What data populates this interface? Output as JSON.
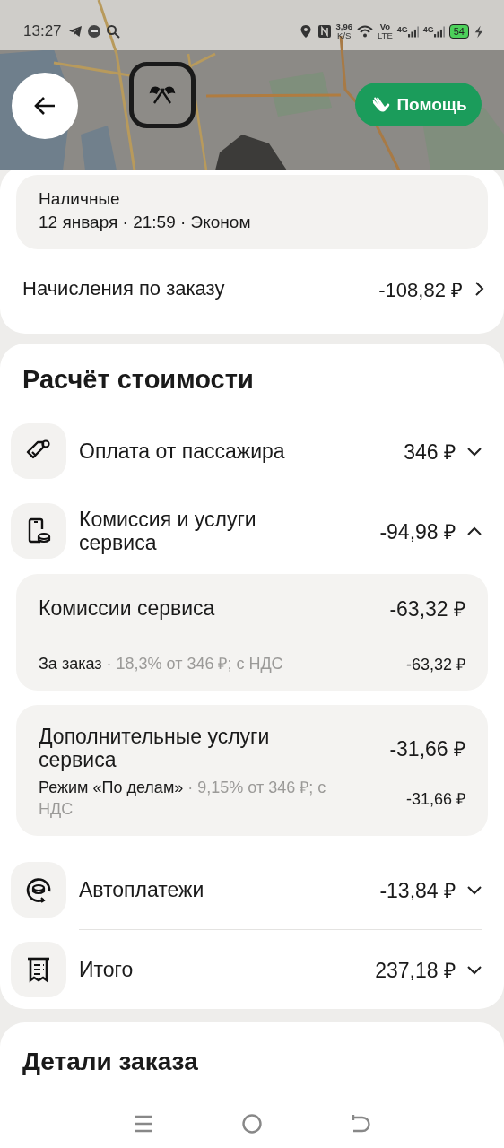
{
  "status_bar": {
    "time": "13:27",
    "network_speed": "3,96",
    "speed_unit": "K/S",
    "volte_top": "Vo",
    "volte_bottom": "LTE",
    "signals": [
      "4G",
      "4G"
    ],
    "battery": "54"
  },
  "help_button": {
    "label": "Помощь"
  },
  "order_summary": {
    "payment": "Наличные",
    "details": "12 января · 21:59 · Эконом"
  },
  "accruals": {
    "label": "Начисления по заказу",
    "amount": "-108,82 ₽"
  },
  "cost_breakdown": {
    "title": "Расчёт стоимости",
    "items": [
      {
        "label": "Оплата от пассажира",
        "amount": "346 ₽",
        "expanded": false
      },
      {
        "label": "Комиссия и услуги сервиса",
        "amount": "-94,98 ₽",
        "expanded": true,
        "details": [
          {
            "title": "Комиссии сервиса",
            "amount": "-63,32 ₽",
            "lines": [
              {
                "label": "За заказ",
                "note": "· 18,3% от 346 ₽; с НДС",
                "amount": "-63,32 ₽"
              }
            ]
          },
          {
            "title": "Дополнительные услуги сервиса",
            "amount": "-31,66 ₽",
            "lines": [
              {
                "label": "Режим «По делам»",
                "note": "· 9,15% от 346 ₽; с НДС",
                "amount": "-31,66 ₽"
              }
            ]
          }
        ]
      },
      {
        "label": "Автоплатежи",
        "amount": "-13,84 ₽",
        "expanded": false
      },
      {
        "label": "Итого",
        "amount": "237,18 ₽",
        "expanded": false
      }
    ]
  },
  "order_details": {
    "title": "Детали заказа"
  }
}
